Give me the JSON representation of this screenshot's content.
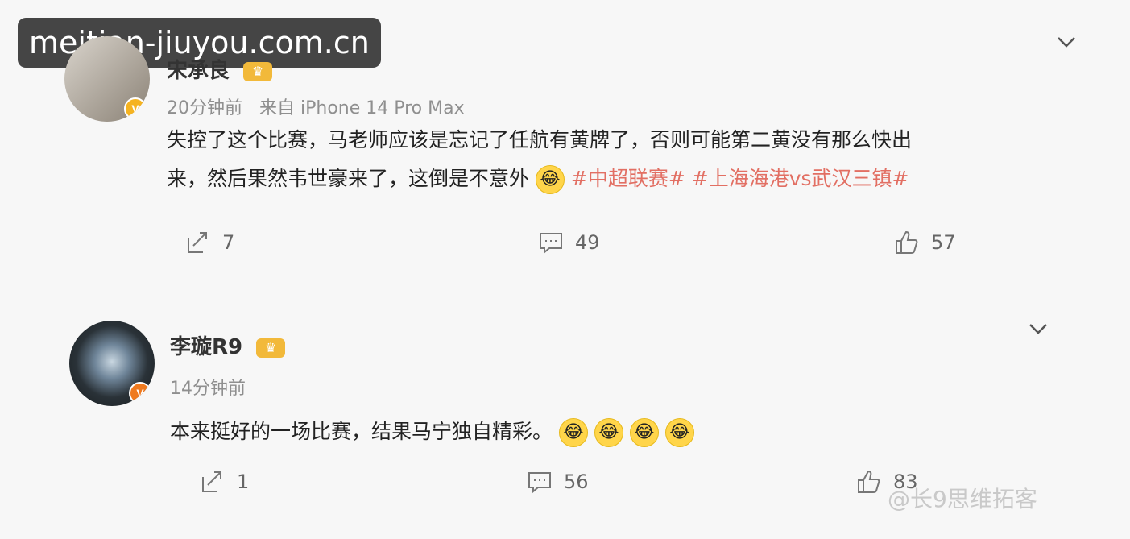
{
  "watermark_top": "meitian-jiuyou.com.cn",
  "watermark_bottom": "@长9思维拓客",
  "posts": [
    {
      "username": "宋承良",
      "time": "20分钟前",
      "device": "来自 iPhone 14 Pro Max",
      "line1": "失控了这个比赛，马老师应该是忘记了任航有黄牌了，否则可能第二黄没有那么快出",
      "line2_text": "来，然后果然韦世豪来了，这倒是不意外",
      "tags": [
        "#中超联赛#",
        "#上海海港vs武汉三镇#"
      ],
      "actions": {
        "share": "7",
        "comment": "49",
        "like": "57"
      },
      "badge": "V"
    },
    {
      "username": "李璇R9",
      "time": "14分钟前",
      "line1": "本来挺好的一场比赛，结果马宁独自精彩。",
      "actions": {
        "share": "1",
        "comment": "56",
        "like": "83"
      },
      "badge": "V"
    }
  ],
  "colors": {
    "background": "#f7f7f7",
    "tag": "#e26f63",
    "meta": "#8f8f8f",
    "text": "#222222"
  }
}
